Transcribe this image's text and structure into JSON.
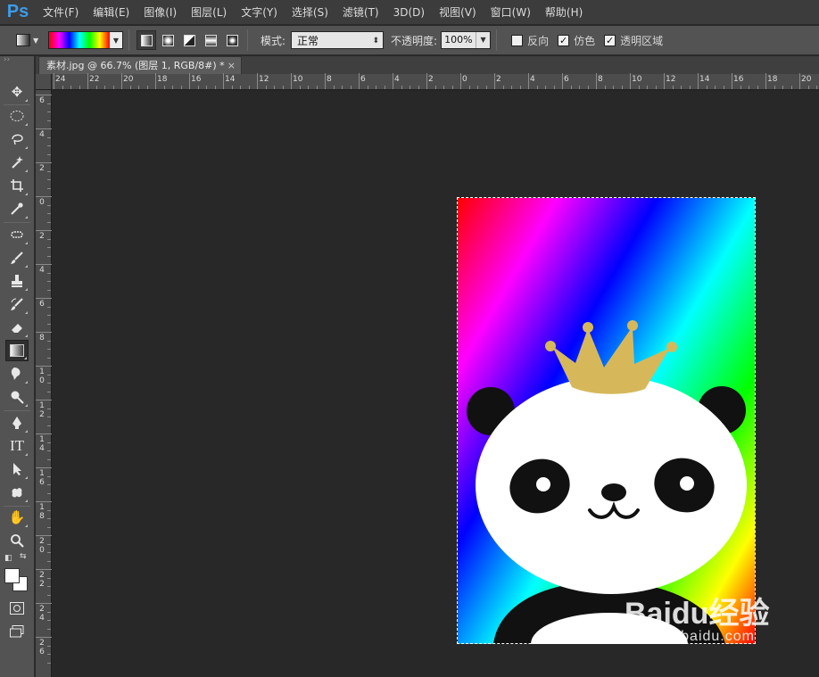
{
  "app": {
    "logo": "Ps"
  },
  "menu": [
    "文件(F)",
    "编辑(E)",
    "图像(I)",
    "图层(L)",
    "文字(Y)",
    "选择(S)",
    "滤镜(T)",
    "3D(D)",
    "视图(V)",
    "窗口(W)",
    "帮助(H)"
  ],
  "options": {
    "mode_label": "模式:",
    "mode_value": "正常",
    "opacity_label": "不透明度:",
    "opacity_value": "100%",
    "reverse_label": "反向",
    "reverse_checked": false,
    "dither_label": "仿色",
    "dither_checked": true,
    "transparency_label": "透明区域",
    "transparency_checked": true,
    "gradient_colors": [
      "#ff0000",
      "#ff00ff",
      "#0000ff",
      "#00ffff",
      "#00ff00",
      "#ffff00",
      "#ff0000"
    ]
  },
  "document": {
    "tab_title": "素材.jpg @ 66.7% (图层 1, RGB/8#) *",
    "close_glyph": "×"
  },
  "ruler": {
    "h_labels": [
      "24",
      "22",
      "20",
      "18",
      "16",
      "14",
      "12",
      "10",
      "8",
      "6",
      "4",
      "2",
      "0",
      "2",
      "4",
      "6",
      "8",
      "10",
      "12",
      "14",
      "16",
      "18",
      "20"
    ],
    "v_labels": [
      "6",
      "4",
      "2",
      "0",
      "2",
      "4",
      "6",
      "8",
      "10",
      "12",
      "14",
      "16",
      "18",
      "20",
      "22",
      "24",
      "26"
    ]
  },
  "tools": [
    "move-tool",
    "marquee-tool",
    "lasso-tool",
    "magic-wand-tool",
    "crop-tool",
    "eyedropper-tool",
    "healing-brush-tool",
    "brush-tool",
    "clone-stamp-tool",
    "history-brush-tool",
    "eraser-tool",
    "gradient-tool",
    "blur-tool",
    "dodge-tool",
    "pen-tool",
    "type-tool",
    "path-selection-tool",
    "shape-tool",
    "hand-tool",
    "zoom-tool"
  ],
  "colors": {
    "foreground": "#ffffff",
    "background": "#ffffff",
    "crown": "#d6b85a"
  },
  "watermark": {
    "logo": "Baidu经验",
    "url": "jingyan.baidu.com"
  }
}
